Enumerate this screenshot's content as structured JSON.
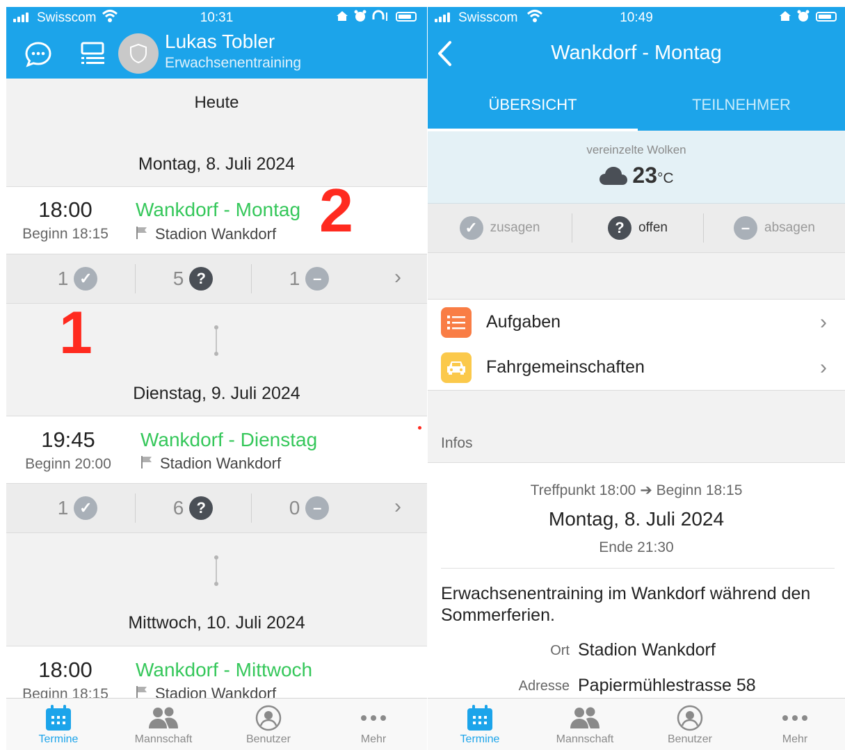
{
  "status_left": {
    "carrier": "Swisscom",
    "time": "10:31"
  },
  "status_right": {
    "carrier": "Swisscom",
    "time": "10:49"
  },
  "left_header": {
    "name": "Lukas Tobler",
    "team": "Erwachsenentraining"
  },
  "left": {
    "today_label": "Heute",
    "events": [
      {
        "date": "Montag, 8. Juli 2024",
        "time": "18:00",
        "begin": "Beginn 18:15",
        "title": "Wankdorf - Montag",
        "location": "Stadion Wankdorf",
        "yes": "1",
        "open": "5",
        "no": "1"
      },
      {
        "date": "Dienstag, 9. Juli 2024",
        "time": "19:45",
        "begin": "Beginn 20:00",
        "title": "Wankdorf - Dienstag",
        "location": "Stadion Wankdorf",
        "yes": "1",
        "open": "6",
        "no": "0"
      },
      {
        "date": "Mittwoch, 10. Juli 2024",
        "time": "18:00",
        "begin": "Beginn 18:15",
        "title": "Wankdorf - Mittwoch",
        "location": "Stadion Wankdorf"
      }
    ],
    "annotation_1": "1",
    "annotation_2": "2"
  },
  "tabs": [
    {
      "label": "Termine",
      "icon": "calendar-icon"
    },
    {
      "label": "Mannschaft",
      "icon": "people-icon"
    },
    {
      "label": "Benutzer",
      "icon": "user-circle-icon"
    },
    {
      "label": "Mehr",
      "icon": "more-icon"
    }
  ],
  "right": {
    "title": "Wankdorf - Montag",
    "tab_overview": "ÜBERSICHT",
    "tab_participants": "TEILNEHMER",
    "weather_desc": "vereinzelte Wolken",
    "temperature": "23",
    "temp_unit": "°C",
    "rsvp": {
      "yes": "zusagen",
      "open": "offen",
      "no": "absagen"
    },
    "rows": [
      {
        "label": "Aufgaben",
        "icon": "tasks-icon",
        "color": "#f97d45"
      },
      {
        "label": "Fahrgemeinschaften",
        "icon": "car-icon",
        "color": "#fbc94b"
      }
    ],
    "infos_label": "Infos",
    "meeting_line": "Treffpunkt 18:00 ➔ Beginn 18:15",
    "date": "Montag, 8. Juli 2024",
    "end": "Ende 21:30",
    "description": "Erwachsenentraining im Wankdorf während den Sommerferien.",
    "ort_label": "Ort",
    "ort_value": "Stadion Wankdorf",
    "adresse_label": "Adresse",
    "adresse_value": "Papiermühlestrasse 58"
  },
  "colors": {
    "primary": "#1ca4ea",
    "event_title": "#35c75a",
    "annotation": "#ff2a1f"
  }
}
